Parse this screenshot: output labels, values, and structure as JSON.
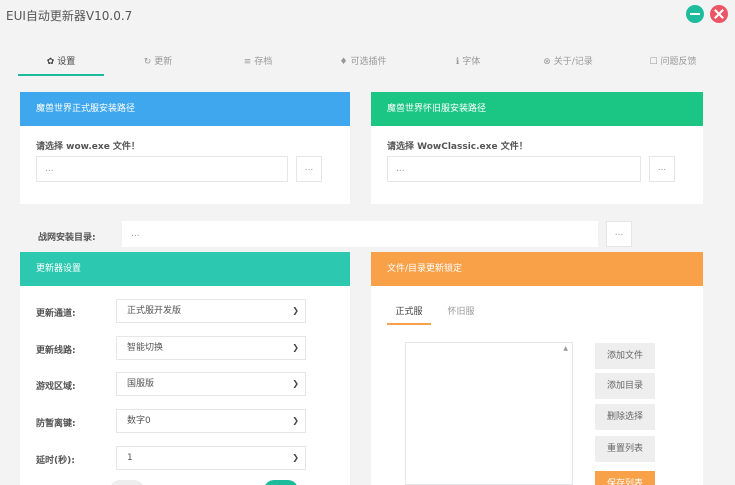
{
  "app": {
    "title": "EUI自动更新器V10.0.7"
  },
  "window": {
    "min_icon": "minimize-icon",
    "close_icon": "close-icon"
  },
  "tabs": [
    {
      "icon": "✿",
      "label": "设置"
    },
    {
      "icon": "↻",
      "label": "更新"
    },
    {
      "icon": "≡",
      "label": "存档"
    },
    {
      "icon": "♦",
      "label": "可选插件"
    },
    {
      "icon": "ℹ",
      "label": "字体"
    },
    {
      "icon": "⊗",
      "label": "关于/记录"
    },
    {
      "icon": "☐",
      "label": "问题反馈"
    }
  ],
  "retail_panel": {
    "title": "魔兽世界正式服安装路径",
    "prompt": "请选择 wow.exe 文件！",
    "path_value": "...",
    "browse_label": "..."
  },
  "classic_panel": {
    "title": "魔兽世界怀旧服安装路径",
    "prompt": "请选择 WowClassic.exe 文件！",
    "path_value": "...",
    "browse_label": "..."
  },
  "battlenet": {
    "label": "战网安装目录:",
    "path_value": "...",
    "browse_label": "..."
  },
  "updater_panel": {
    "title": "更新器设置",
    "rows": [
      {
        "label": "更新通道:",
        "value": "正式服开发版"
      },
      {
        "label": "更新线路:",
        "value": "智能切换"
      },
      {
        "label": "游戏区域:",
        "value": "国服版"
      },
      {
        "label": "防暂离键:",
        "value": "数字0"
      },
      {
        "label": "延时(秒):",
        "value": "1"
      }
    ]
  },
  "lock_panel": {
    "title": "文件/目录更新锁定",
    "subtabs": [
      "正式服",
      "怀旧服"
    ],
    "buttons": [
      "添加文件",
      "添加目录",
      "删除选择",
      "重置列表",
      "保存列表"
    ]
  },
  "colors": {
    "accent": "#1cbc9c",
    "blue": "#3ea7ee",
    "green": "#1bc685",
    "teal": "#2cc8b0",
    "orange": "#f8a148",
    "close": "#ec5565"
  }
}
